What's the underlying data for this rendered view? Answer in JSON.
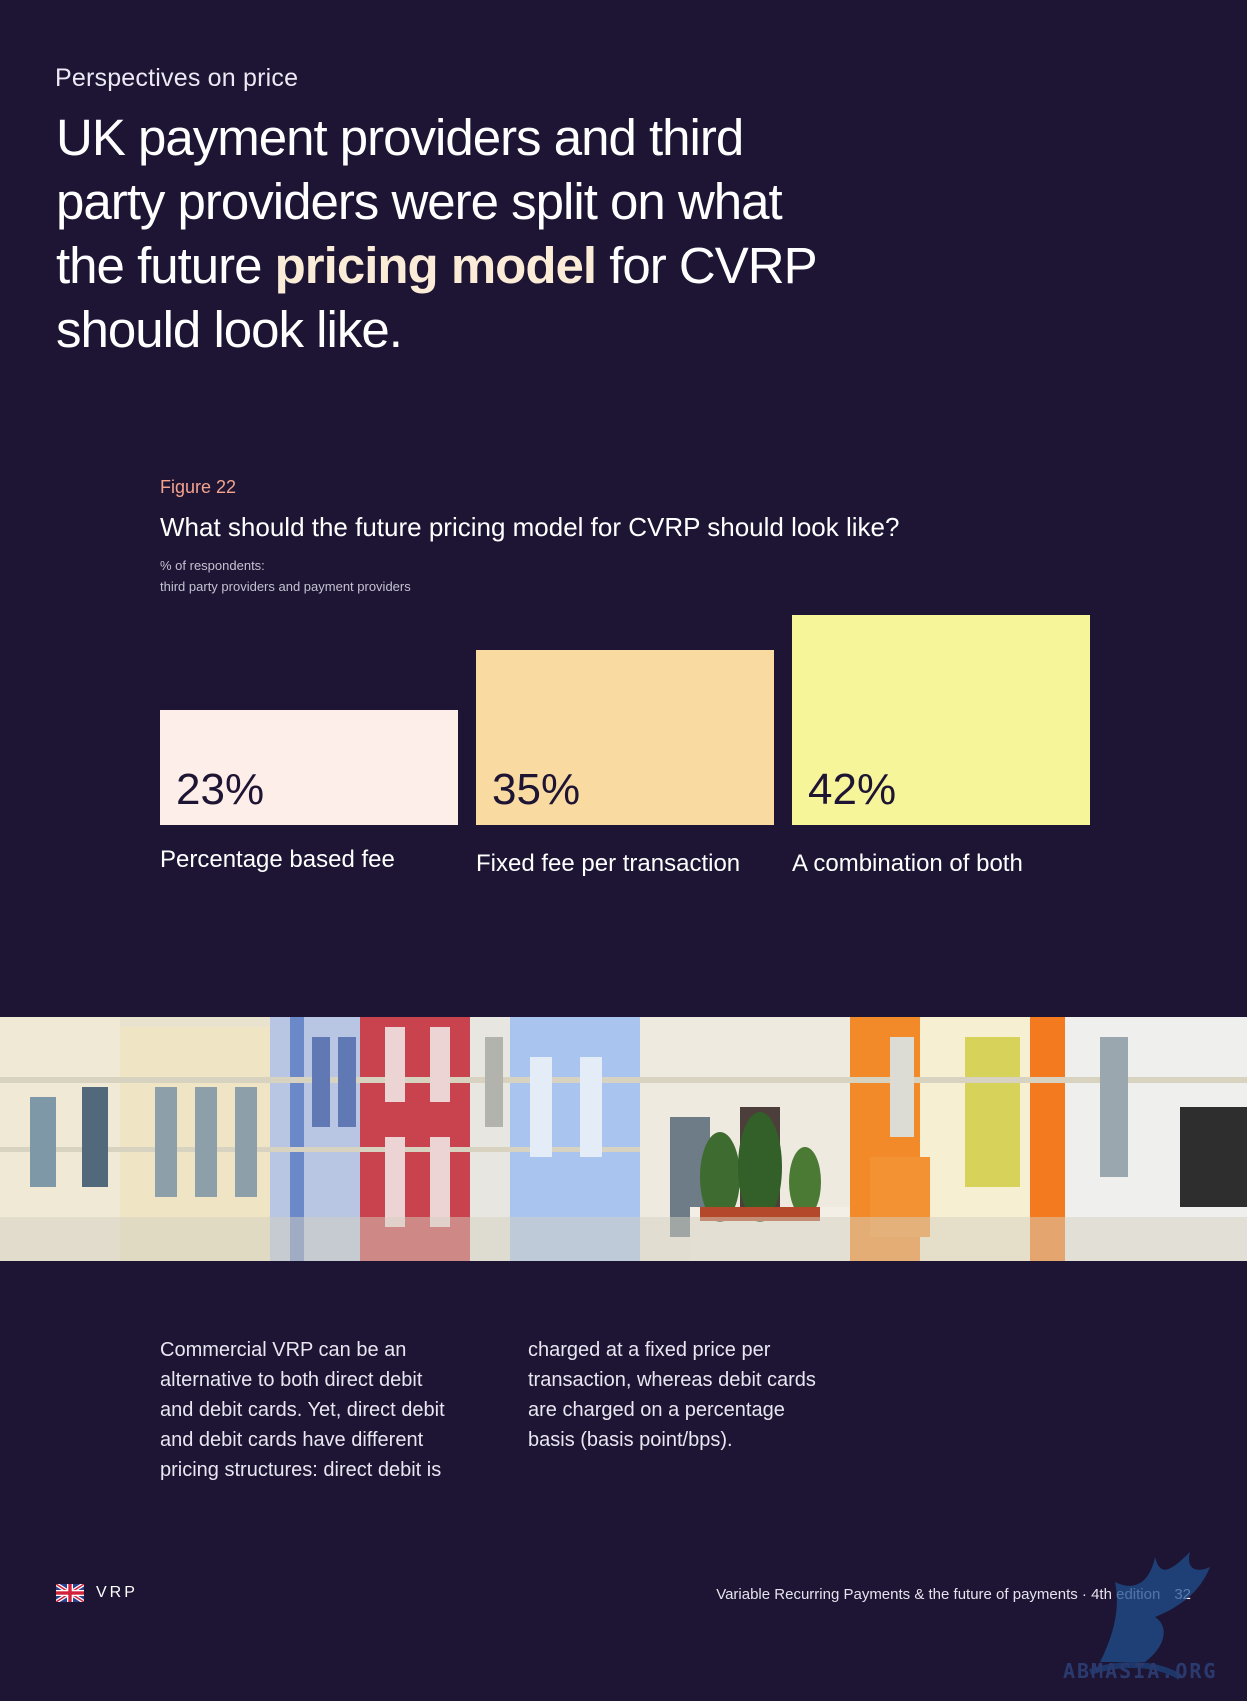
{
  "page": {
    "eyebrow": "Perspectives on price",
    "headline": {
      "part1": "UK payment providers and third party providers were split on what the future ",
      "highlight": "pricing model",
      "part2": " for CVRP should look like."
    }
  },
  "figure": {
    "label": "Figure 22",
    "title": "What should the future pricing model for CVRP should look like?",
    "subtitle_line1": "% of respondents:",
    "subtitle_line2": "third party providers and payment providers"
  },
  "chart_data": {
    "type": "bar",
    "categories": [
      "Percentage based fee",
      "Fixed fee per transaction",
      "A combination of both"
    ],
    "values": [
      23,
      35,
      42
    ],
    "value_labels": [
      "23%",
      "35%",
      "42%"
    ],
    "colors": [
      "#fdeee9",
      "#f9dba2",
      "#f7f59a"
    ],
    "title": "What should the future pricing model for CVRP should look like?",
    "ylabel": "% of respondents",
    "ylim": [
      0,
      42
    ],
    "grid": false,
    "legend": "none"
  },
  "body": {
    "col1": [
      "Commercial VRP can be an",
      "alternative to both direct debit",
      "and debit cards. Yet, direct debit",
      "and debit cards have different",
      "pricing structures: direct debit is"
    ],
    "col2": [
      "charged at a fixed price per",
      "transaction, whereas debit cards",
      "are charged on a percentage",
      "basis (basis point/bps)."
    ]
  },
  "footer": {
    "tag": "VRP",
    "publication": "Variable Recurring Payments & the future of payments · 4th edition",
    "page_number": "32",
    "flag_icon": "uk-flag-icon"
  },
  "watermark": {
    "text": "ABMASIA.ORG"
  }
}
